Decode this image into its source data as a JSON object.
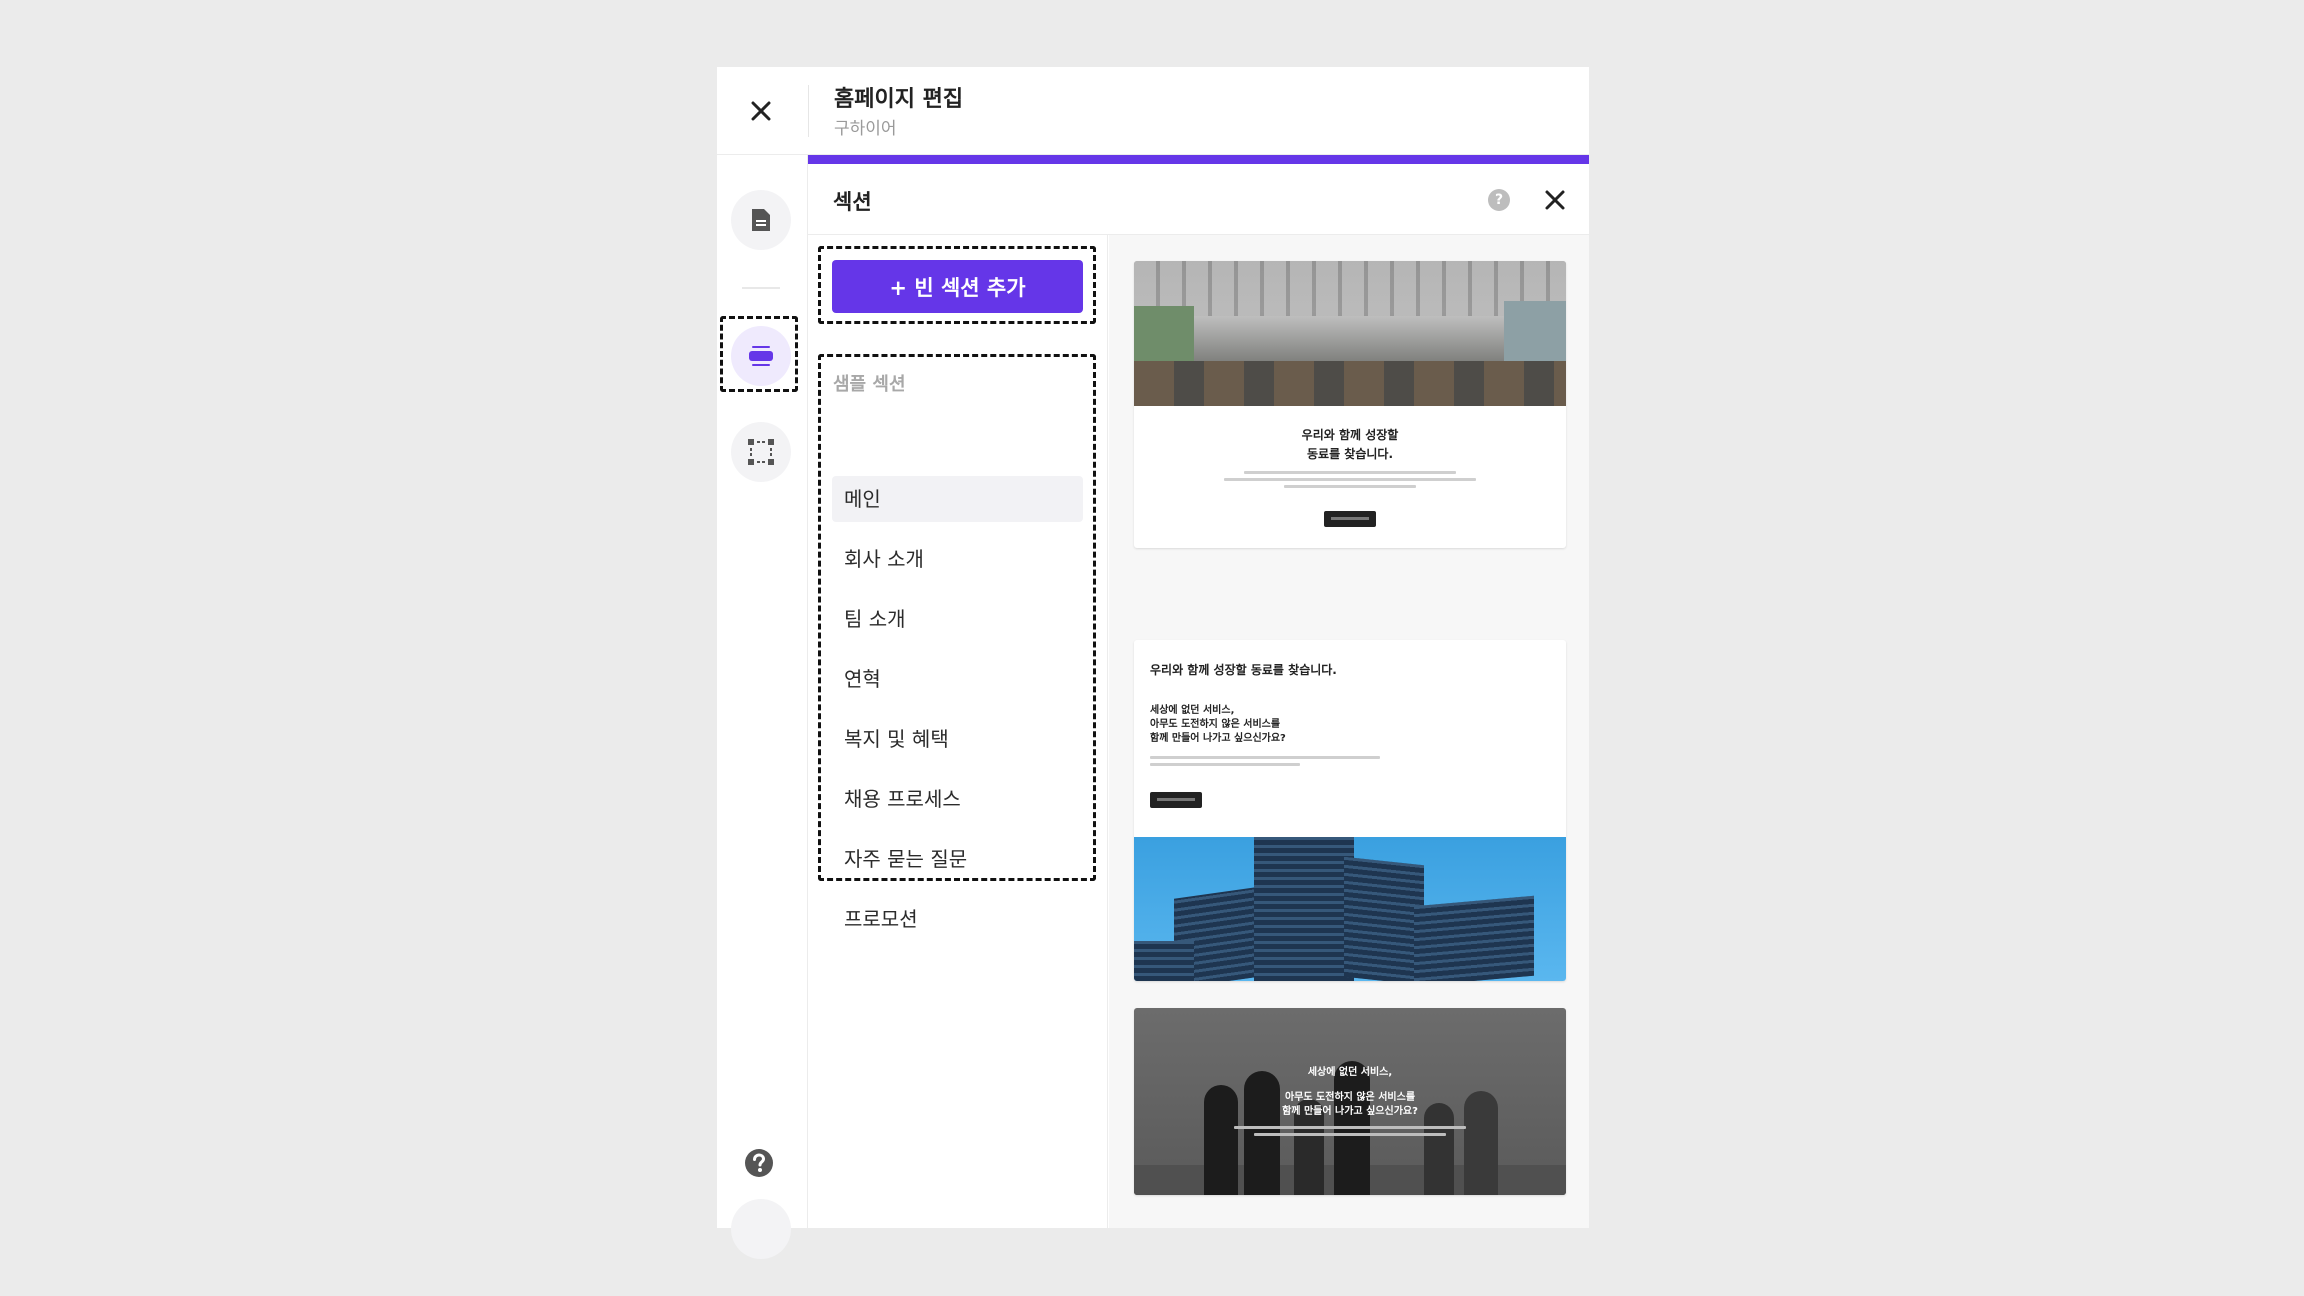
{
  "header": {
    "title": "홈페이지 편집",
    "subtitle": "구하이어"
  },
  "rail": {
    "items": [
      {
        "icon": "document-icon",
        "active": false
      },
      {
        "icon": "section-icon",
        "active": true
      },
      {
        "icon": "element-icon",
        "active": false
      }
    ],
    "help_icon": "help-icon"
  },
  "section_panel": {
    "title": "섹션",
    "help": "?",
    "add_button": "+ 빈 섹션 추가",
    "list_label": "샘플 섹션",
    "items": [
      {
        "label": "메인",
        "selected": true
      },
      {
        "label": "회사 소개",
        "selected": false
      },
      {
        "label": "팀 소개",
        "selected": false
      },
      {
        "label": "연혁",
        "selected": false
      },
      {
        "label": "복지 및 혜택",
        "selected": false
      },
      {
        "label": "채용 프로세스",
        "selected": false
      },
      {
        "label": "자주 묻는 질문",
        "selected": false
      },
      {
        "label": "프로모션",
        "selected": false
      }
    ]
  },
  "previews": {
    "card1": {
      "line1": "우리와 함께 성장할",
      "line2": "동료를 찾습니다."
    },
    "card2": {
      "heading": "우리와 함께 성장할 동료를 찾습니다.",
      "sub1": "세상에 없던 서비스,",
      "sub2": "아무도 도전하지 않은 서비스를",
      "sub3": "함께 만들어 나가고 싶으신가요?"
    },
    "card3": {
      "line1": "세상에 없던 서비스,",
      "line2": "아무도 도전하지 않은 서비스를",
      "line3": "함께 만들어 나가고 싶으신가요?"
    }
  },
  "colors": {
    "accent": "#6536e8",
    "background": "#ebebeb"
  }
}
